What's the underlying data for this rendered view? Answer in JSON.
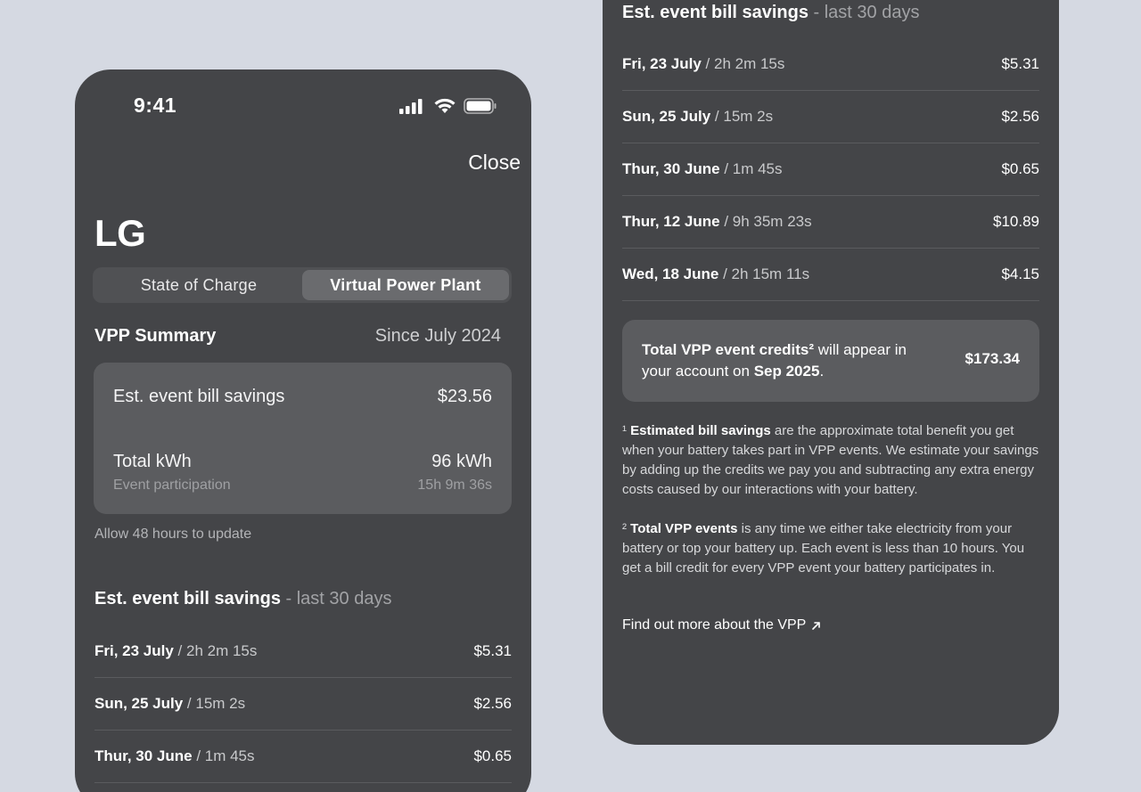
{
  "status": {
    "time": "9:41"
  },
  "header": {
    "close_label": "Close",
    "brand": "LG"
  },
  "tabs": [
    {
      "label": "State of Charge",
      "active": false
    },
    {
      "label": "Virtual Power Plant",
      "active": true
    }
  ],
  "summary": {
    "title": "VPP Summary",
    "since": "Since July 2024",
    "bill_savings_label": "Est. event bill savings",
    "bill_savings_value": "$23.56",
    "kwh_label": "Total kWh",
    "kwh_value": "96 kWh",
    "participation_label": "Event participation",
    "participation_value": "15h 9m 36s",
    "update_note": "Allow 48 hours to update"
  },
  "savings_section": {
    "title": "Est. event bill savings",
    "suffix": " - last 30 days"
  },
  "events": [
    {
      "date": "Fri, 23 July",
      "duration": " / 2h 2m 15s",
      "amount": "$5.31"
    },
    {
      "date": "Sun, 25 July",
      "duration": " / 15m 2s",
      "amount": "$2.56"
    },
    {
      "date": "Thur, 30 June",
      "duration": " / 1m 45s",
      "amount": "$0.65"
    },
    {
      "date": "Thur, 12 June",
      "duration": " / 9h 35m 23s",
      "amount": "$10.89"
    },
    {
      "date": "Wed, 18 June",
      "duration": " / 2h 15m 11s",
      "amount": "$4.15"
    }
  ],
  "credits": {
    "bold_lead": "Total VPP event credits²",
    "middle": " will appear in your account on ",
    "bold_date": "Sep 2025",
    "end": ".",
    "amount": "$173.34"
  },
  "footnotes": {
    "one_marker": "¹ ",
    "one_bold": "Estimated bill savings",
    "one_text": " are the approximate total benefit you get when your battery takes part in VPP events. We estimate your savings by adding up the credits we pay you and subtracting any extra energy costs caused by our interactions with your battery.",
    "two_marker": "² ",
    "two_bold": "Total VPP events",
    "two_text": " is any time we either take electricity from your battery or top your battery up. Each event is less than 10 hours. You get a bill credit for every VPP event your battery participates in."
  },
  "link": {
    "label": "Find out more about the VPP",
    "icon": "arrow-up-right-icon"
  }
}
